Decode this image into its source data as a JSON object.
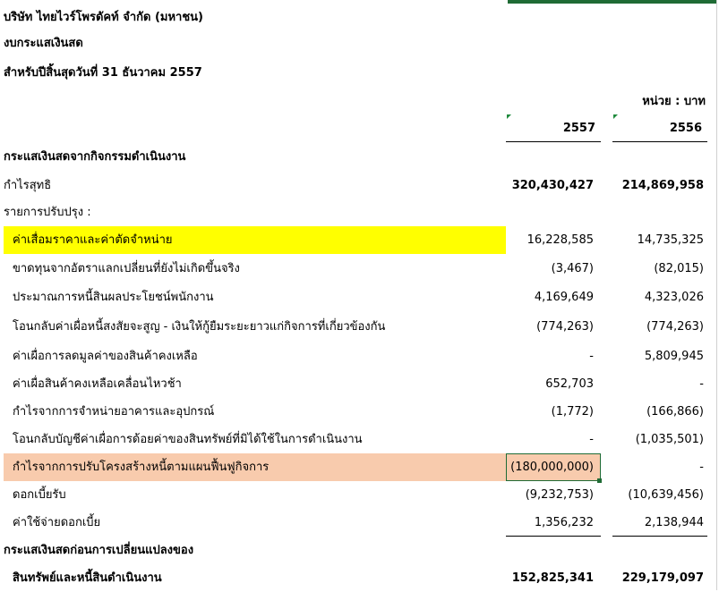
{
  "header": {
    "company": "บริษัท ไทยไวร์โพรดัคท์ จำกัด (มหาชน)",
    "statement": "งบกระแสเงินสด",
    "period": "สำหรับปีสิ้นสุดวันที่ 31 ธันวาคม 2557",
    "unit": "หน่วย : บาท",
    "year1": "2557",
    "year2": "2556"
  },
  "rows": [
    {
      "label": "กระแสเงินสดจากกิจกรรมดำเนินงาน",
      "v1": "",
      "v2": ""
    },
    {
      "label": "กำไรสุทธิ",
      "v1": "320,430,427",
      "v2": "214,869,958"
    },
    {
      "label": "รายการปรับปรุง :",
      "v1": "",
      "v2": ""
    },
    {
      "label": "ค่าเสื่อมราคาและค่าตัดจำหน่าย",
      "v1": "16,228,585",
      "v2": "14,735,325"
    },
    {
      "label": "ขาดทุนจากอัตราแลกเปลี่ยนที่ยังไม่เกิดขึ้นจริง",
      "v1": "(3,467)",
      "v2": "(82,015)"
    },
    {
      "label": "ประมาณการหนี้สินผลประโยชน์พนักงาน",
      "v1": "4,169,649",
      "v2": "4,323,026"
    },
    {
      "label": "โอนกลับค่าเผื่อหนี้สงสัยจะสูญ - เงินให้กู้ยืมระยะยาวแก่กิจการที่เกี่ยวข้องกัน",
      "v1": "(774,263)",
      "v2": "(774,263)"
    },
    {
      "label": "ค่าเผื่อการลดมูลค่าของสินค้าคงเหลือ",
      "v1": "-",
      "v2": "5,809,945"
    },
    {
      "label": "ค่าเผื่อสินค้าคงเหลือเคลื่อนไหวช้า",
      "v1": "652,703",
      "v2": "-"
    },
    {
      "label": "กำไรจากการจำหน่ายอาคารและอุปกรณ์",
      "v1": "(1,772)",
      "v2": "(166,866)"
    },
    {
      "label": "โอนกลับบัญชีค่าเผื่อการด้อยค่าของสินทรัพย์ที่มิได้ใช้ในการดำเนินงาน",
      "v1": "-",
      "v2": "(1,035,501)"
    },
    {
      "label": "กำไรจากการปรับโครงสร้างหนี้ตามแผนฟื้นฟูกิจการ",
      "v1": "(180,000,000)",
      "v2": "-"
    },
    {
      "label": "ดอกเบี้ยรับ",
      "v1": "(9,232,753)",
      "v2": "(10,639,456)"
    },
    {
      "label": "ค่าใช้จ่ายดอกเบี้ย",
      "v1": "1,356,232",
      "v2": "2,138,944"
    },
    {
      "label": "กระแสเงินสดก่อนการเปลี่ยนแปลงของ",
      "v1": "",
      "v2": ""
    },
    {
      "label": "สินทรัพย์และหนี้สินดำเนินงาน",
      "v1": "152,825,341",
      "v2": "229,179,097"
    }
  ],
  "colors": {
    "highlight_yellow": "#ffff00",
    "highlight_peach": "#f8cbad",
    "selection_border": "#1f6b35"
  }
}
